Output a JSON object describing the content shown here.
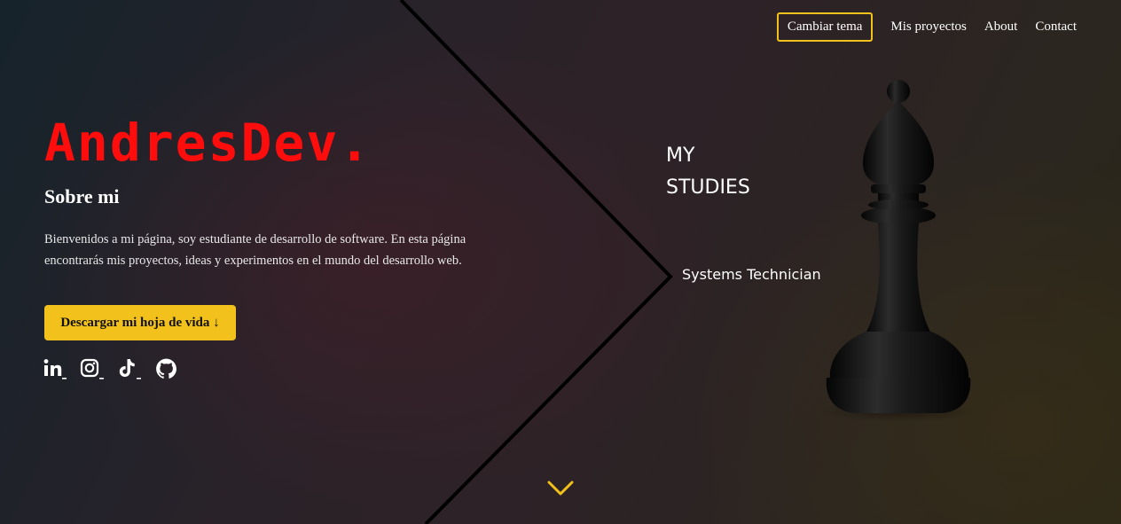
{
  "nav": {
    "theme_button": "Cambiar tema",
    "links": [
      "Mis proyectos",
      "About",
      "Contact"
    ]
  },
  "hero": {
    "brand": "AndresDev.",
    "about_title": "Sobre mi",
    "about_text": "Bienvenidos a mi página, soy estudiante de desarrollo de software. En esta página encontrarás mis proyectos, ideas y experimentos en el mundo del desarrollo web.",
    "cv_button": "Descargar mi hoja de vida ↓"
  },
  "socials": [
    "linkedin-icon",
    "instagram-icon",
    "tiktok-icon",
    "github-icon"
  ],
  "studies": {
    "title_line1": "MY",
    "title_line2": "STUDIES",
    "items": [
      "Systems Technician"
    ]
  },
  "colors": {
    "accent": "#f2c11c",
    "brand": "#ff0d0d",
    "text": "#ffffff"
  }
}
